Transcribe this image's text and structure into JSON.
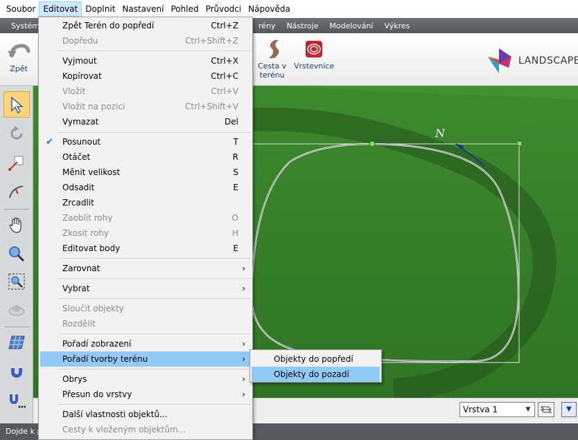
{
  "menubar": {
    "items": [
      {
        "label": "Soubor",
        "active": false
      },
      {
        "label": "Editovat",
        "active": true
      },
      {
        "label": "Doplnit",
        "active": false
      },
      {
        "label": "Nastavení",
        "active": false
      },
      {
        "label": "Pohled",
        "active": false
      },
      {
        "label": "Průvodci",
        "active": false
      },
      {
        "label": "Nápověda",
        "active": false
      }
    ]
  },
  "ribbon_tabs": [
    "Systém",
    "rény",
    "Nástroje",
    "Modelování",
    "Výkres"
  ],
  "toolbar": {
    "undo_label": "Zpět",
    "road_label_1": "Cesta v",
    "road_label_2": "terénu",
    "contours_label": "Vrstevnice",
    "logo_text": "LANDSCAPE"
  },
  "edit_menu": {
    "items": [
      {
        "label": "Zpět Terén do popředí",
        "shortcut": "Ctrl+Z",
        "disabled": false
      },
      {
        "label": "Dopředu",
        "shortcut": "Ctrl+Shift+Z",
        "disabled": true
      },
      {
        "label": "Vyjmout",
        "shortcut": "Ctrl+X",
        "disabled": false
      },
      {
        "label": "Kopírovat",
        "shortcut": "Ctrl+C",
        "disabled": false
      },
      {
        "label": "Vložit",
        "shortcut": "Ctrl+V",
        "disabled": true
      },
      {
        "label": "Vložit na pozici",
        "shortcut": "Ctrl+Shift+V",
        "disabled": true
      },
      {
        "label": "Vymazat",
        "shortcut": "Del",
        "disabled": false
      },
      {
        "label": "Posunout",
        "shortcut": "T",
        "disabled": false,
        "checked": true
      },
      {
        "label": "Otáčet",
        "shortcut": "R",
        "disabled": false
      },
      {
        "label": "Měnit velikost",
        "shortcut": "S",
        "disabled": false
      },
      {
        "label": "Odsadit",
        "shortcut": "E",
        "disabled": false
      },
      {
        "label": "Zrcadlit",
        "shortcut": "",
        "disabled": false
      },
      {
        "label": "Zaoblit rohy",
        "shortcut": "O",
        "disabled": true
      },
      {
        "label": "Zkosit rohy",
        "shortcut": "H",
        "disabled": true
      },
      {
        "label": "Editovat body",
        "shortcut": "E",
        "disabled": false
      },
      {
        "label": "Zarovnat",
        "submenu": true,
        "disabled": false
      },
      {
        "label": "Vybrat",
        "submenu": true,
        "disabled": false
      },
      {
        "label": "Sloučit objekty",
        "shortcut": "",
        "disabled": true
      },
      {
        "label": "Rozdělit",
        "shortcut": "",
        "disabled": true
      },
      {
        "label": "Pořadí zobrazení",
        "submenu": true,
        "disabled": false
      },
      {
        "label": "Pořadí tvorby terénu",
        "submenu": true,
        "disabled": false,
        "highlighted": true
      },
      {
        "label": "Obrys",
        "submenu": true,
        "disabled": false
      },
      {
        "label": "Přesun do vrstvy",
        "submenu": true,
        "disabled": false
      },
      {
        "label": "Další vlastnosti objektů...",
        "shortcut": "",
        "disabled": false
      },
      {
        "label": "Cesty k vloženým objektům...",
        "shortcut": "",
        "disabled": true
      }
    ],
    "submenu_arrow": "›",
    "check_mark": "✔"
  },
  "terrain_submenu": {
    "items": [
      {
        "label": "Objekty do popředí",
        "highlighted": false
      },
      {
        "label": "Objekty do pozadí",
        "highlighted": true
      }
    ]
  },
  "bottom": {
    "layer_value": "Vrstva 1",
    "status_text": "Dojde k p"
  },
  "viewport": {
    "compass_label": "N"
  },
  "colors": {
    "grass": "#3f8a2c",
    "highlight": "#91c9f7",
    "menu_bg": "#f2f2f2",
    "ribbon_bg": "#5f6164"
  }
}
